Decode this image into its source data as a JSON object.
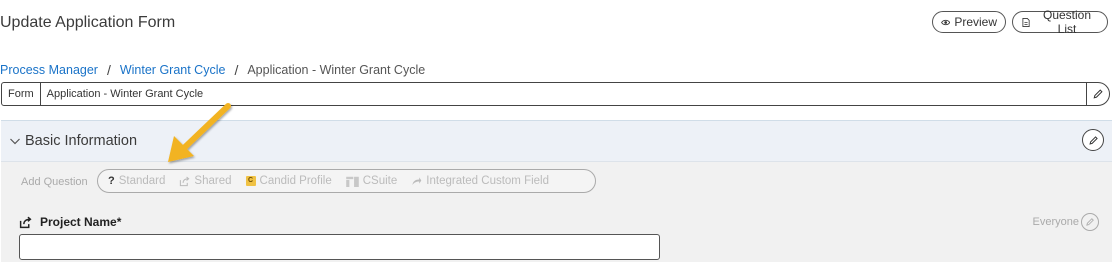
{
  "page_title": "Update Application Form",
  "top_buttons": {
    "preview": "Preview",
    "question_list": "Question List"
  },
  "breadcrumb": {
    "items": [
      "Process Manager",
      "Winter Grant Cycle"
    ],
    "current": "Application - Winter Grant Cycle",
    "separator": "/"
  },
  "form_bar": {
    "label": "Form",
    "value": "Application - Winter Grant Cycle"
  },
  "section": {
    "title": "Basic Information"
  },
  "add_question": {
    "label": "Add Question",
    "options": [
      {
        "label": "Standard",
        "icon": "question-mark-icon"
      },
      {
        "label": "Shared",
        "icon": "share-icon"
      },
      {
        "label": "Candid Profile",
        "icon": "candid-icon",
        "badge": "C"
      },
      {
        "label": "CSuite",
        "icon": "csuite-icon"
      },
      {
        "label": "Integrated Custom Field",
        "icon": "integration-icon"
      }
    ]
  },
  "field": {
    "label": "Project Name*",
    "value": "",
    "visibility": "Everyone"
  },
  "colors": {
    "link": "#1a73c8",
    "panel_header": "#edf1f7",
    "panel_body": "#f1f1f1",
    "arrow": "#f2b321"
  }
}
